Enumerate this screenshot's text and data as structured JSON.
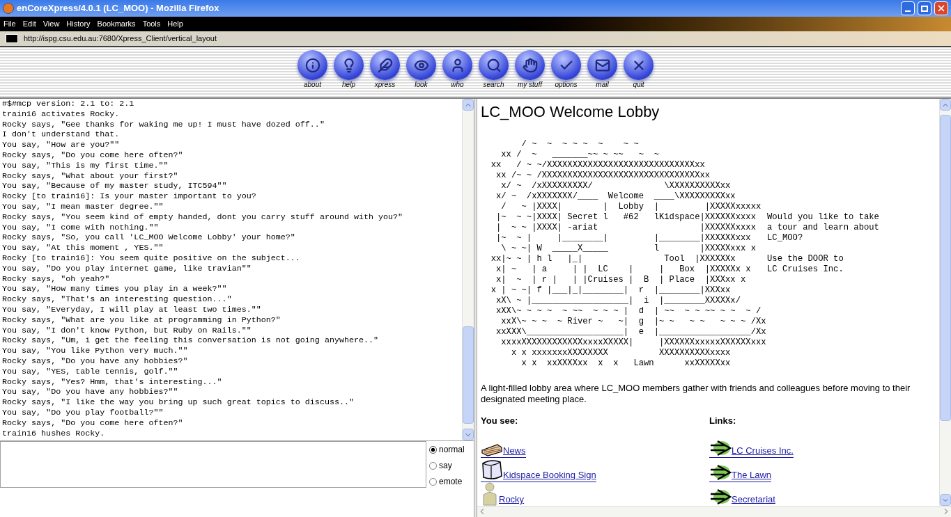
{
  "window": {
    "title": "enCoreXpress/4.0.1 (LC_MOO) - Mozilla Firefox"
  },
  "menu": [
    "File",
    "Edit",
    "View",
    "History",
    "Bookmarks",
    "Tools",
    "Help"
  ],
  "address_bar": {
    "url": "http://ispg.csu.edu.au:7680/Xpress_Client/vertical_layout"
  },
  "toolbar": [
    "about",
    "help",
    "xpress",
    "look",
    "who",
    "search",
    "my stuff",
    "options",
    "mail",
    "quit"
  ],
  "chat": {
    "lines": [
      "#$#mcp version: 2.1 to: 2.1",
      "train16 activates Rocky.",
      "Rocky says, \"Gee thanks for waking me up! I must have dozed off..\"",
      "I don't understand that.",
      "You say, \"How are you?\"\"",
      "Rocky says, \"Do you come here often?\"",
      "You say, \"This is my first time.\"\"",
      "Rocky says, \"What about your first?\"",
      "You say, \"Because of my master study, ITC594\"\"",
      "Rocky [to train16]: Is your master important to you?",
      "You say, \"I mean master degree.\"\"",
      "Rocky says, \"You seem kind of empty handed, dont you carry stuff around with you?\"",
      "You say, \"I come with nothing.\"\"",
      "Rocky says, \"So, you call 'LC_MOO Welcome Lobby' your home?\"",
      "You say, \"At this moment , YES.\"\"",
      "Rocky [to train16]: You seem quite positive on the subject...",
      "You say, \"Do you play internet game, like travian\"\"",
      "Rocky says, \"oh yeah?\"",
      "You say, \"How many times you play in a week?\"\"",
      "Rocky says, \"That's an interesting question...\"",
      "You say, \"Everyday, I will play at least two times.\"\"",
      "Rocky says, \"What are you like at programming in Python?\"",
      "You say, \"I don't know Python, but Ruby on Rails.\"\"",
      "Rocky says, \"Um, i get the feeling this conversation is not going anywhere..\"",
      "You say, \"You like Python very much.\"\"",
      "Rocky says, \"Do you have any hobbies?\"",
      "You say, \"YES, table tennis, golf.\"\"",
      "Rocky says, \"Yes? Hmm, that's interesting...\"",
      "You say, \"Do you have any hobbies?\"\"",
      "Rocky says, \"I like the way you bring up such great topics to discuss..\"",
      "You say, \"Do you play football?\"\"",
      "Rocky says, \"Do you come here often?\"",
      "train16 hushes Rocky."
    ]
  },
  "input": {
    "modes": [
      {
        "label": "normal",
        "selected": true
      },
      {
        "label": "say",
        "selected": false
      },
      {
        "label": "emote",
        "selected": false
      }
    ]
  },
  "room": {
    "title": "LC_MOO Welcome Lobby",
    "map_lines": [
      "        / ~  ~  ~ ~ ~  ~    ~ ~",
      "    xx /  ~   _______~~ ~ ~~   ~  ~",
      "  xx   / ~ ~/XXXXXXXXXXXXXXXXXXXXXXXXXXXXXxx",
      "   xx /~ ~ /XXXXXXXXXXXXXXXXXXXXXXXXXXXXXXXxx",
      "    x/ ~  /xXXXXXXXXX/              \\XXXXXXXXXXxx",
      "   x/ ~  /xXXXXXXX/____  Welcome  ____\\XXXXXXXXXxx",
      "    /   ~ |XXXX|        |  Lobby  |         |XXXXXxxxxx",
      "   |~  ~ ~|XXXX| Secret l   #62   lKidspace|XXXXXXxxxx",
      "   |  ~ ~ |XXXX| -ariat                    |XXXXXXxxxx",
      "   |~  ~ |     |________|         |________|XXXXXXxxx",
      "    \\ ~ ~| W  _____X_____         l        |XXXXXxxx x",
      "  xx|~ ~ | h l   |_|                Tool  |XXXXXXx",
      "   x| ~   | a     | |  LC    |     |   Box  |XXXXXx x",
      "   x|  ~  | r |   | |Cruises |  B  | Place  |XXXxx x",
      "  x | ~ ~| f |___|_|________|  r  |________|XXXxx",
      "   xX\\ ~ |___________________|  i  |________XXXXXx/",
      "   xXX\\~ ~ ~ ~  ~ ~~  ~ ~ ~ |  d  | ~~  ~ ~ ~~ ~ ~  ~ /",
      "    xxX\\~ ~ ~  ~ River ~   ~|  g  |~ ~   ~ ~   ~ ~ ~ /Xx",
      "   xxXXX\\___________________|  e  |__________________/Xx",
      "    xxxxXXXXXXXXXXXXxxxxXXXXX|     |XXXXXXxxxxxXXXXXXxxx",
      "      x x xxxxxxxXXXXXXXX          XXXXXXXXXXxxxx",
      "        x x  xxXXXXxx  x  x   Lawn      xxXXXXXxx"
    ],
    "side_notes": [
      [
        "Would you like to take",
        "a tour and learn about",
        "LC_MOO?"
      ],
      [
        "Use the DOOR to",
        "LC Cruises Inc."
      ]
    ],
    "description": "A light-filled lobby area where LC_MOO members gather with friends and colleagues before moving to their designated meeting place.",
    "you_see": {
      "heading": "You see:",
      "items": [
        {
          "label": "News",
          "kind": "newspaper"
        },
        {
          "label": "Kidspace Booking Sign",
          "kind": "sign"
        },
        {
          "label": "Rocky",
          "kind": "person"
        }
      ]
    },
    "links": {
      "heading": "Links:",
      "items": [
        {
          "label": "LC Cruises Inc."
        },
        {
          "label": "The Lawn"
        },
        {
          "label": "Secretariat"
        }
      ]
    }
  }
}
